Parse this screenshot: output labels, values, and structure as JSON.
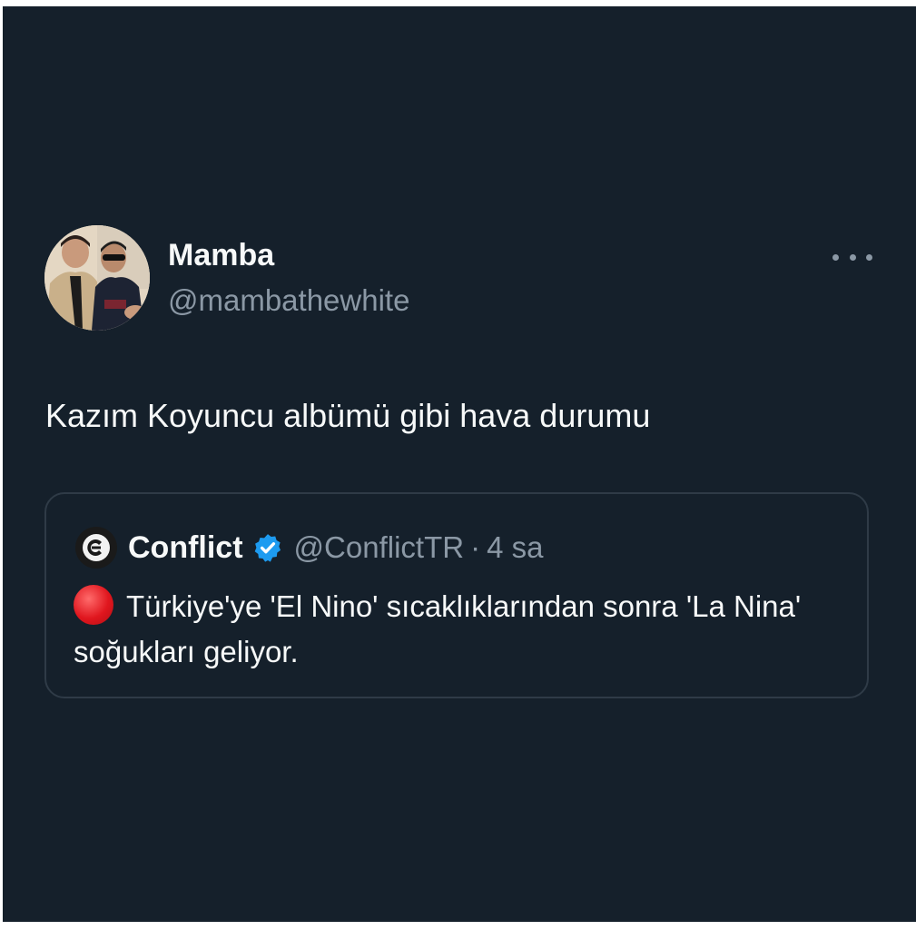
{
  "tweet": {
    "display_name": "Mamba",
    "handle": "@mambathewhite",
    "text": "Kazım Koyuncu albümü gibi hava durumu",
    "more_icon": "more-horizontal-icon"
  },
  "quote": {
    "display_name": "Conflict",
    "handle": "@ConflictTR",
    "separator": "·",
    "time": "4 sa",
    "avatar_letter": "C",
    "verified_icon": "verified-badge-icon",
    "text": "Türkiye'ye 'El Nino' sıcaklıklarından sonra 'La Nina' soğukları geliyor.",
    "leading_icon": "red-circle-icon"
  },
  "colors": {
    "background": "#15202b",
    "primary_text": "#f7f9f9",
    "secondary_text": "#8b98a5",
    "verified": "#1d9bf0",
    "card_border": "#2f3b47"
  }
}
